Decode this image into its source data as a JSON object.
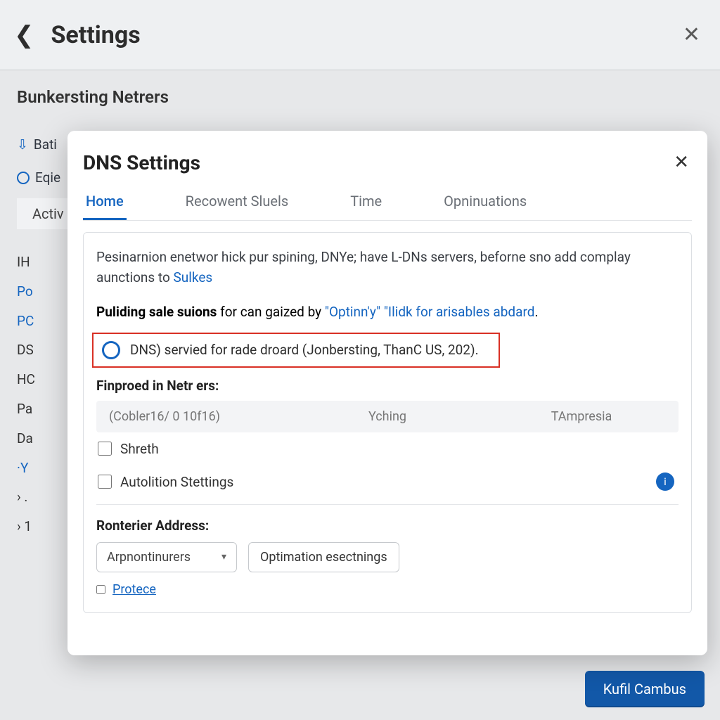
{
  "header": {
    "title": "Settings"
  },
  "page": {
    "heading": "Bunkersting Netrers",
    "row1": "Bati",
    "row2": "Eqie",
    "tab": "Activ",
    "list": [
      "IH",
      "Po",
      "PC",
      "DS",
      "HC",
      "Pa",
      "Da",
      "·Y",
      "› .",
      "› 1"
    ]
  },
  "modal": {
    "title": "DNS Settings",
    "tabs": [
      {
        "label": "Home",
        "active": true
      },
      {
        "label": "Recowent Sluels",
        "active": false
      },
      {
        "label": "Time",
        "active": false
      },
      {
        "label": "Opninuations",
        "active": false
      }
    ],
    "desc_prefix": "Pesinarnion enetwor hick pur spining, DNYe; have L-DNs servers, beforne sno add complay aunctions to ",
    "desc_link": "Sulkes",
    "subdesc_bold": "Puliding sale suions",
    "subdesc_mid": " for can gaized by ",
    "subdesc_link1": "\"Optinn'y\"",
    "subdesc_link2": "\"Ilidk for arisables abdard",
    "subdesc_end": ".",
    "highlight_label": "DNS) servied for rade droard (Jonbersting, ThanC US, 202).",
    "section_label": "Finproed in Netr ers:",
    "table_cols": [
      "(Cobler16/ 0 10f16)",
      "Yching",
      "TAmpresia"
    ],
    "check1": "Shreth",
    "check2": "Autolition Stettings",
    "addr_label": "Ronterier Address:",
    "select_value": "Arpnontinurers",
    "opt_button": "Optimation esectnings",
    "protect_label": "Protece"
  },
  "footer": {
    "primary": "Kufil Cambus"
  }
}
